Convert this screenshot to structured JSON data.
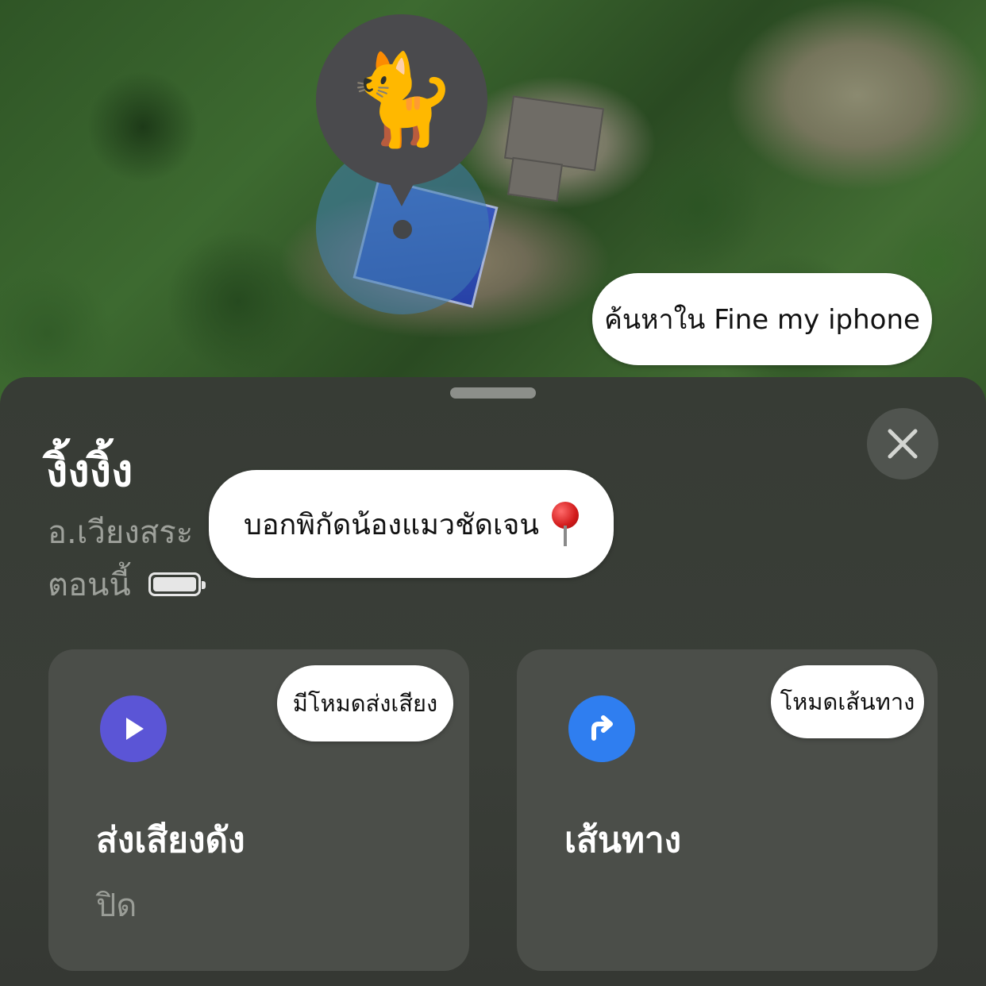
{
  "map": {
    "pet_emoji": "🐈",
    "search_bubble": "ค้นหาใน Fine my iphone"
  },
  "sheet": {
    "title": "งิ้งงิ้ง",
    "location": "อ.เวียงสระ",
    "time": "ตอนนี้",
    "battery_level": 1.0,
    "location_bubble": "บอกพิกัดน้องแมวชัดเจน"
  },
  "actions": {
    "sound": {
      "title": "ส่งเสียงดัง",
      "status": "ปิด",
      "bubble": "มีโหมดส่งเสียง",
      "accent": "#5b55d6",
      "icon": "play-icon"
    },
    "route": {
      "title": "เส้นทาง",
      "bubble": "โหมดเส้นทาง",
      "accent": "#2f7ef0",
      "icon": "turn-right-arrow-icon"
    }
  }
}
